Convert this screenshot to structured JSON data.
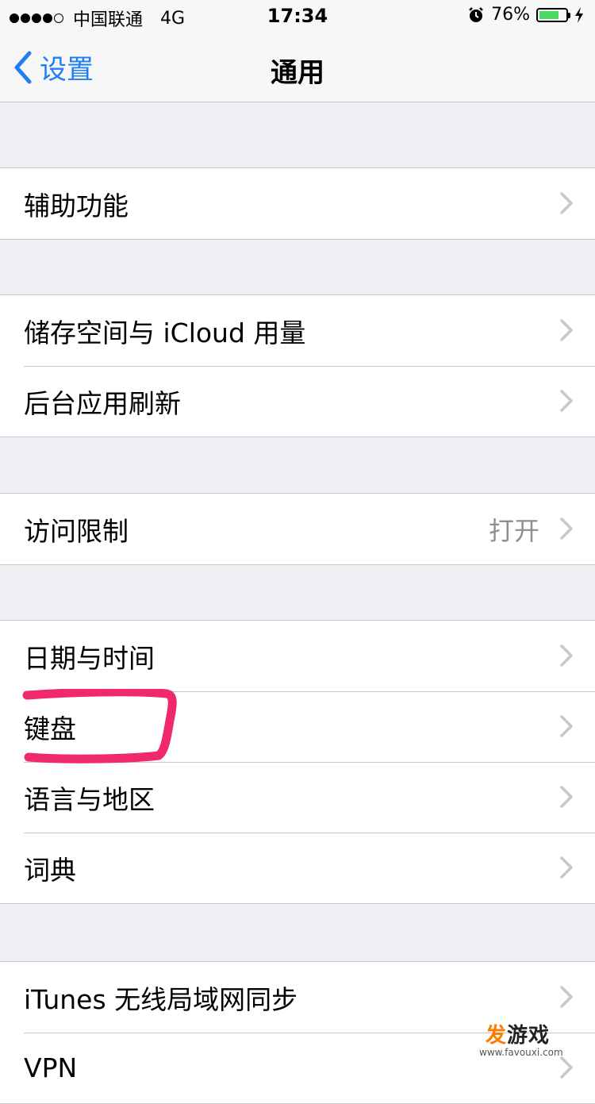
{
  "status": {
    "carrier": "中国联通",
    "network": "4G",
    "time": "17:34",
    "battery": "76%",
    "battery_level": 0.76
  },
  "nav": {
    "back_label": "设置",
    "title": "通用"
  },
  "groups": [
    {
      "rows": [
        {
          "label": "辅助功能"
        }
      ]
    },
    {
      "rows": [
        {
          "label": "储存空间与 iCloud 用量"
        },
        {
          "label": "后台应用刷新"
        }
      ]
    },
    {
      "rows": [
        {
          "label": "访问限制",
          "value": "打开"
        }
      ]
    },
    {
      "rows": [
        {
          "label": "日期与时间"
        },
        {
          "label": "键盘"
        },
        {
          "label": "语言与地区"
        },
        {
          "label": "词典"
        }
      ]
    },
    {
      "rows": [
        {
          "label": "iTunes 无线局域网同步"
        },
        {
          "label": "VPN"
        }
      ]
    }
  ],
  "watermark": {
    "brand_fa": "发",
    "brand_rest": "游戏",
    "url": "www.favouxi.com"
  },
  "colors": {
    "accent": "#1f7ef0",
    "background": "#efeff4",
    "battery": "#4cd964",
    "highlight": "#f0286e"
  }
}
